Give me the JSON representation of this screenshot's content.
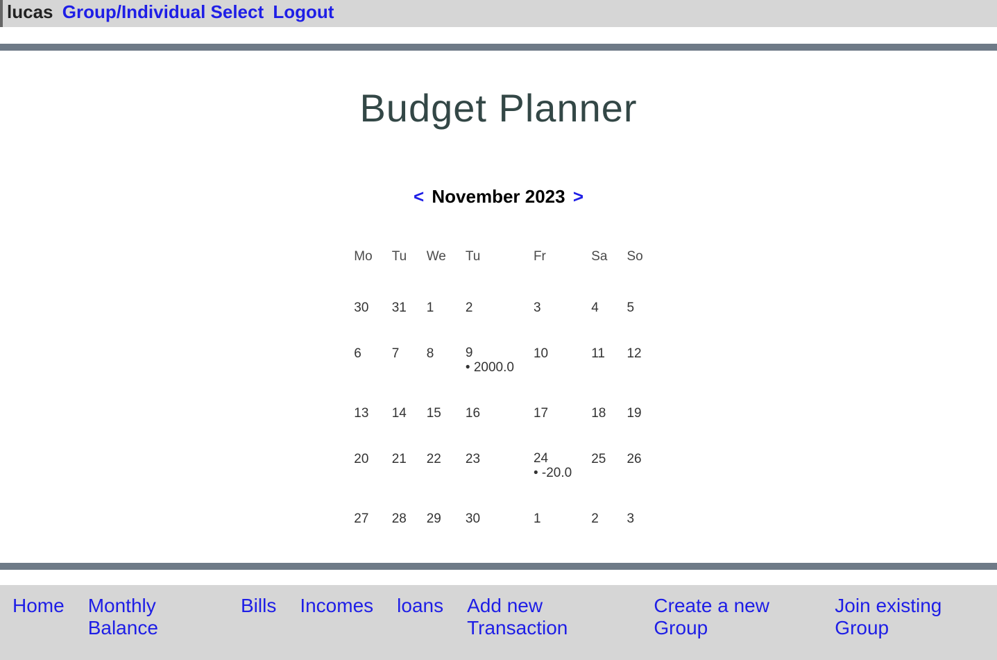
{
  "header": {
    "username": "lucas",
    "group_select_label": "Group/Individual Select",
    "logout_label": "Logout"
  },
  "page": {
    "title": "Budget Planner"
  },
  "calendar": {
    "prev_arrow": "<",
    "next_arrow": ">",
    "month_label": "November 2023",
    "weekdays": [
      "Mo",
      "Tu",
      "We",
      "Tu",
      "Fr",
      "Sa",
      "So"
    ],
    "rows": [
      [
        {
          "d": "30"
        },
        {
          "d": "31"
        },
        {
          "d": "1"
        },
        {
          "d": "2"
        },
        {
          "d": "3"
        },
        {
          "d": "4"
        },
        {
          "d": "5"
        }
      ],
      [
        {
          "d": "6"
        },
        {
          "d": "7"
        },
        {
          "d": "8"
        },
        {
          "d": "9",
          "amount": "2000.0"
        },
        {
          "d": "10"
        },
        {
          "d": "11"
        },
        {
          "d": "12"
        }
      ],
      [
        {
          "d": "13"
        },
        {
          "d": "14"
        },
        {
          "d": "15"
        },
        {
          "d": "16"
        },
        {
          "d": "17"
        },
        {
          "d": "18"
        },
        {
          "d": "19"
        }
      ],
      [
        {
          "d": "20"
        },
        {
          "d": "21"
        },
        {
          "d": "22"
        },
        {
          "d": "23"
        },
        {
          "d": "24",
          "amount": "-20.0"
        },
        {
          "d": "25"
        },
        {
          "d": "26"
        }
      ],
      [
        {
          "d": "27"
        },
        {
          "d": "28"
        },
        {
          "d": "29"
        },
        {
          "d": "30"
        },
        {
          "d": "1"
        },
        {
          "d": "2"
        },
        {
          "d": "3"
        }
      ]
    ]
  },
  "footer": {
    "home": "Home",
    "monthly_balance": "Monthly Balance",
    "bills": "Bills",
    "incomes": "Incomes",
    "loans": "loans",
    "add_transaction": "Add new Transaction",
    "create_group": "Create a new Group",
    "join_group": "Join existing Group"
  }
}
